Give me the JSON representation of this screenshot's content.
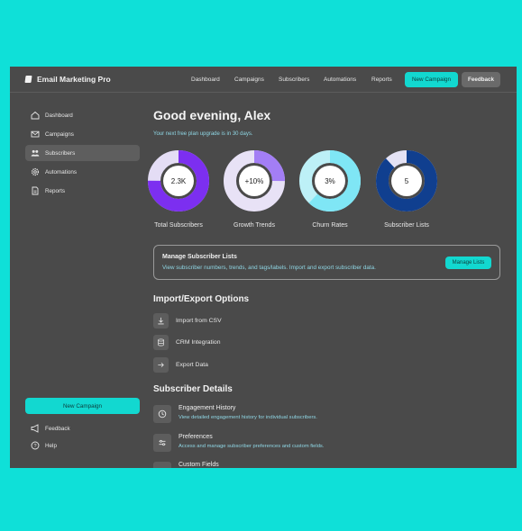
{
  "brand": {
    "name": "Email Marketing Pro",
    "icon": "logo-icon"
  },
  "topnav": {
    "items": [
      "Dashboard",
      "Campaigns",
      "Subscribers",
      "Automations",
      "Reports"
    ],
    "new_campaign": "New Campaign",
    "feedback": "Feedback"
  },
  "sidebar": {
    "items": [
      {
        "label": "Dashboard",
        "icon": "home-icon"
      },
      {
        "label": "Campaigns",
        "icon": "mail-icon"
      },
      {
        "label": "Subscribers",
        "icon": "users-icon",
        "active": true
      },
      {
        "label": "Automations",
        "icon": "gear-icon"
      },
      {
        "label": "Reports",
        "icon": "document-icon"
      }
    ],
    "cta": "New Campaign",
    "footer": [
      {
        "label": "Feedback",
        "icon": "megaphone-icon"
      },
      {
        "label": "Help",
        "icon": "help-icon"
      }
    ]
  },
  "main": {
    "greeting": "Good evening, Alex",
    "subtitle": "Your next free plan upgrade is in 30 days.",
    "stats": [
      {
        "value": "2.3K",
        "label": "Total Subscribers",
        "fill": 0.75,
        "color": "#7c2ff0",
        "track": "#e4ddf5"
      },
      {
        "value": "+10%",
        "label": "Growth Trends",
        "fill": 0.25,
        "color": "#a37ef5",
        "track": "#e8e2f6"
      },
      {
        "value": "3%",
        "label": "Churn Rates",
        "fill": 0.62,
        "color": "#7fe6f5",
        "track": "#bdf0f7"
      },
      {
        "value": "5",
        "label": "Subscriber Lists",
        "fill": 0.88,
        "color": "#103f8f",
        "track": "#e4e2f4"
      }
    ],
    "manage": {
      "title": "Manage Subscriber Lists",
      "description": "View subscriber numbers, trends, and tags/labels. Import and export subscriber data.",
      "button": "Manage Lists"
    },
    "import_export": {
      "title": "Import/Export Options",
      "items": [
        {
          "label": "Import from CSV",
          "icon": "download-icon"
        },
        {
          "label": "CRM Integration",
          "icon": "database-icon"
        },
        {
          "label": "Export Data",
          "icon": "arrow-right-icon"
        }
      ]
    },
    "details": {
      "title": "Subscriber Details",
      "items": [
        {
          "title": "Engagement History",
          "description": "View detailed engagement history for individual subscribers.",
          "icon": "clock-icon"
        },
        {
          "title": "Preferences",
          "description": "Access and manage subscriber preferences and custom fields.",
          "icon": "sliders-icon"
        },
        {
          "title": "Custom Fields",
          "description": "",
          "icon": "list-icon"
        }
      ]
    }
  }
}
